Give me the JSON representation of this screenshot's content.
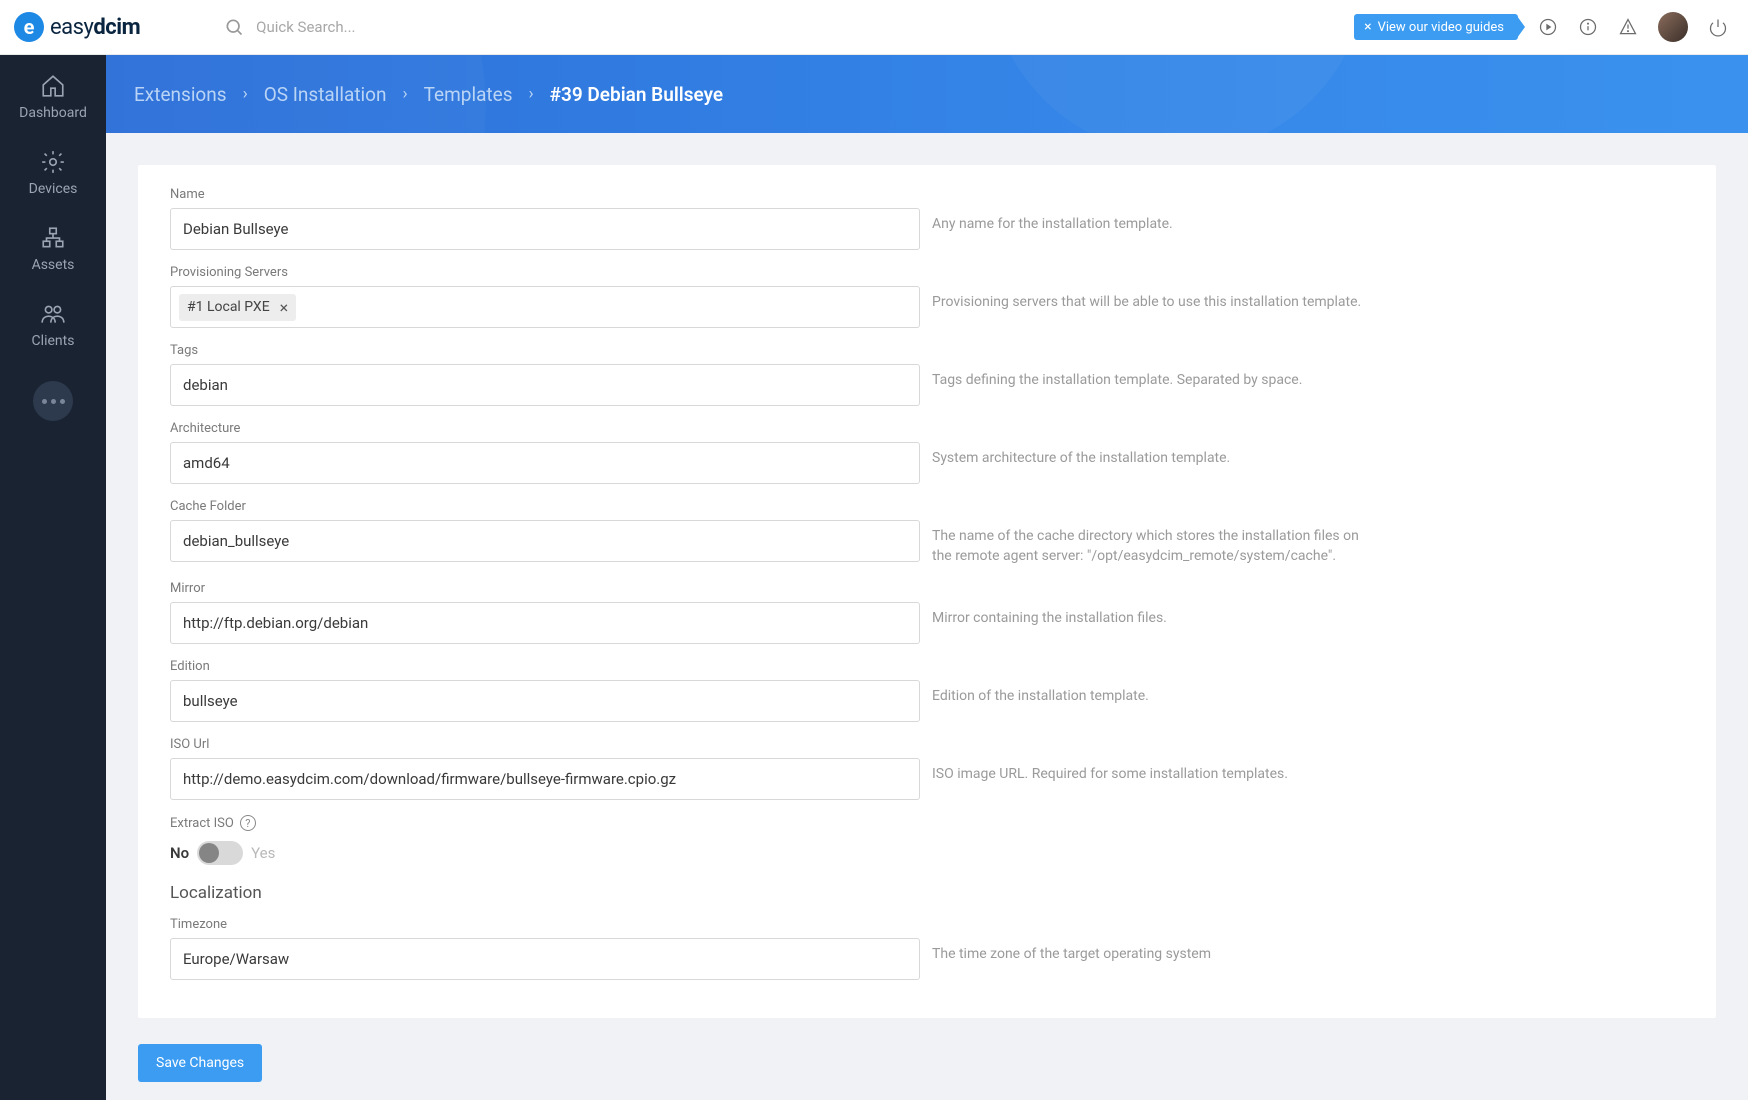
{
  "header": {
    "logo_text_prefix": "easy",
    "logo_text_bold": "dcim",
    "search_placeholder": "Quick Search...",
    "video_guides": "View our video guides",
    "video_guides_x": "×"
  },
  "sidebar": {
    "items": [
      {
        "label": "Dashboard"
      },
      {
        "label": "Devices"
      },
      {
        "label": "Assets"
      },
      {
        "label": "Clients"
      }
    ]
  },
  "breadcrumb": {
    "items": [
      "Extensions",
      "OS Installation",
      "Templates"
    ],
    "current": "#39 Debian Bullseye"
  },
  "form": {
    "name": {
      "label": "Name",
      "value": "Debian Bullseye",
      "help": "Any name for the installation template."
    },
    "provisioning": {
      "label": "Provisioning Servers",
      "chip": "#1 Local PXE",
      "help": "Provisioning servers that will be able to use this installation template."
    },
    "tags": {
      "label": "Tags",
      "value": "debian",
      "help": "Tags defining the installation template. Separated by space."
    },
    "arch": {
      "label": "Architecture",
      "value": "amd64",
      "help": "System architecture of the installation template."
    },
    "cache": {
      "label": "Cache Folder",
      "value": "debian_bullseye",
      "help": "The name of the cache directory which stores the installation files on the remote agent server: \"/opt/easydcim_remote/system/cache\"."
    },
    "mirror": {
      "label": "Mirror",
      "value": "http://ftp.debian.org/debian",
      "help": "Mirror containing the installation files."
    },
    "edition": {
      "label": "Edition",
      "value": "bullseye",
      "help": "Edition of the installation template."
    },
    "iso": {
      "label": "ISO Url",
      "value": "http://demo.easydcim.com/download/firmware/bullseye-firmware.cpio.gz",
      "help": "ISO image URL. Required for some installation templates."
    },
    "extract": {
      "label": "Extract ISO",
      "no": "No",
      "yes": "Yes"
    },
    "localization_title": "Localization",
    "timezone": {
      "label": "Timezone",
      "value": "Europe/Warsaw",
      "help": "The time zone of the target operating system"
    }
  },
  "footer": {
    "save": "Save Changes"
  }
}
